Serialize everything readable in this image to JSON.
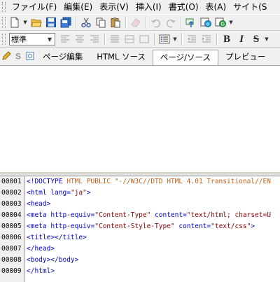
{
  "menubar": {
    "items": [
      "ファイル(F)",
      "編集(E)",
      "表示(V)",
      "挿入(I)",
      "書式(O)",
      "表(A)",
      "サイト(S"
    ]
  },
  "toolbar2": {
    "style_select_value": "標準",
    "format_bold": "B",
    "format_italic": "I",
    "format_strike": "S"
  },
  "tabs": {
    "items": [
      {
        "label": "ページ編集",
        "active": false
      },
      {
        "label": "HTML ソース",
        "active": false
      },
      {
        "label": "ページ/ソース",
        "active": true
      },
      {
        "label": "プレビュー",
        "active": false
      }
    ]
  },
  "source": {
    "line_numbers": [
      "00001",
      "00002",
      "00003",
      "00004",
      "00005",
      "00006",
      "00007",
      "00008",
      "00009"
    ],
    "lines": [
      {
        "parts": [
          {
            "c": "tag",
            "t": "<!DOCTYPE"
          },
          {
            "c": "doc",
            "t": " HTML PUBLIC \"-//W3C//DTD HTML 4.01 Transitional//EN"
          }
        ]
      },
      {
        "parts": [
          {
            "c": "tag",
            "t": "<html"
          },
          {
            "c": "attr",
            "t": " lang="
          },
          {
            "c": "val",
            "t": "\"ja\""
          },
          {
            "c": "tag",
            "t": ">"
          }
        ]
      },
      {
        "parts": [
          {
            "c": "tag",
            "t": "<head>"
          }
        ]
      },
      {
        "parts": [
          {
            "c": "tag",
            "t": "<meta"
          },
          {
            "c": "attr",
            "t": " http-equiv="
          },
          {
            "c": "val",
            "t": "\"Content-Type\""
          },
          {
            "c": "attr",
            "t": " content="
          },
          {
            "c": "val",
            "t": "\"text/html; charset=U"
          }
        ]
      },
      {
        "parts": [
          {
            "c": "tag",
            "t": "<meta"
          },
          {
            "c": "attr",
            "t": " http-equiv="
          },
          {
            "c": "val",
            "t": "\"Content-Style-Type\""
          },
          {
            "c": "attr",
            "t": " content="
          },
          {
            "c": "val",
            "t": "\"text/css\""
          },
          {
            "c": "tag",
            "t": ">"
          }
        ]
      },
      {
        "parts": [
          {
            "c": "tag",
            "t": "<title></title>"
          }
        ]
      },
      {
        "parts": [
          {
            "c": "tag",
            "t": "</head>"
          }
        ]
      },
      {
        "parts": [
          {
            "c": "tag",
            "t": "<body></body>"
          }
        ]
      },
      {
        "parts": [
          {
            "c": "tag",
            "t": "</html>"
          }
        ]
      }
    ]
  },
  "colors": {
    "tag": "#0000cc",
    "value": "#8b0000",
    "doctype": "#c0601a",
    "chrome": "#f0f0f0"
  },
  "icons": {
    "toolbar1": [
      "new-page-icon",
      "open-folder-icon",
      "save-icon",
      "save-all-icon",
      "cut-icon",
      "copy-icon",
      "paste-icon",
      "eraser-icon",
      "undo-icon",
      "redo-icon",
      "publish-icon",
      "browser-preview-icon",
      "web-settings-icon"
    ],
    "toolbar2": [
      "align-left-icon",
      "align-center-icon",
      "align-right-icon",
      "justify-icon",
      "list-icon",
      "outdent-icon",
      "indent-icon",
      "bold-icon",
      "italic-icon",
      "strike-icon"
    ],
    "tabbar": [
      "pencil-icon",
      "s-icon",
      "page-icon"
    ]
  }
}
